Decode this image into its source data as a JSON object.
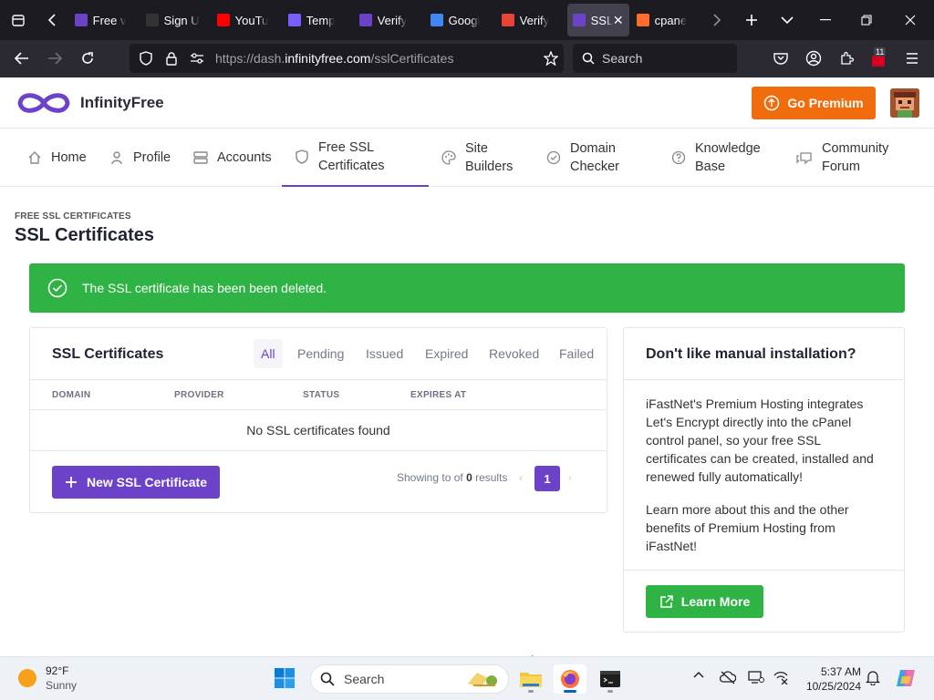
{
  "browser": {
    "tabs": [
      {
        "label": "Free v",
        "favicon_color": "#6b42c8"
      },
      {
        "label": "Sign U",
        "favicon_color": "#333"
      },
      {
        "label": "YouTu",
        "favicon_color": "#ff0000"
      },
      {
        "label": "Temp",
        "favicon_color": "#7b5cff"
      },
      {
        "label": "Verify",
        "favicon_color": "#6b42c8"
      },
      {
        "label": "Googl",
        "favicon_color": "#4285f4"
      },
      {
        "label": "Verify",
        "favicon_color": "#ea4335"
      },
      {
        "label": "SSL",
        "favicon_color": "#6b42c8"
      },
      {
        "label": "cpane",
        "favicon_color": "#ff6c2c"
      }
    ],
    "url_prefix": "https://dash.",
    "url_domain": "infinityfree.com",
    "url_path": "/sslCertificates",
    "search_placeholder": "Search",
    "extension_badge": "11"
  },
  "site": {
    "logo_text": "InfinityFree",
    "premium_button": "Go Premium",
    "nav": [
      {
        "label": "Home",
        "icon": "home-icon"
      },
      {
        "label": "Profile",
        "icon": "user-icon"
      },
      {
        "label": "Accounts",
        "icon": "server-icon"
      },
      {
        "label": "Free SSL Certificates",
        "icon": "shield-icon"
      },
      {
        "label": "Site Builders",
        "icon": "palette-icon"
      },
      {
        "label": "Domain Checker",
        "icon": "check-circle-icon"
      },
      {
        "label": "Knowledge Base",
        "icon": "help-circle-icon"
      },
      {
        "label": "Community Forum",
        "icon": "messages-icon"
      }
    ],
    "nav_active": "Free SSL Certificates"
  },
  "page": {
    "eyebrow": "FREE SSL CERTIFICATES",
    "title": "SSL Certificates",
    "alert": "The SSL certificate has been been deleted."
  },
  "ssl_card": {
    "title": "SSL Certificates",
    "filters": [
      "All",
      "Pending",
      "Issued",
      "Expired",
      "Revoked",
      "Failed"
    ],
    "active_filter": "All",
    "columns": [
      "DOMAIN",
      "PROVIDER",
      "STATUS",
      "EXPIRES AT"
    ],
    "empty_text": "No SSL certificates found",
    "new_button": "New SSL Certificate",
    "showing_prefix": "Showing to of ",
    "showing_count": "0",
    "showing_suffix": " results",
    "pager_prev": "‹",
    "current_page": "1",
    "pager_next": "›"
  },
  "side_card": {
    "title": "Don't like manual installation?",
    "paragraph1": "iFastNet's Premium Hosting integrates Let's Encrypt directly into the cPanel control panel, so your free SSL certificates can be created, installed and renewed fully automatically!",
    "paragraph2": "Learn more about this and the other benefits of Premium Hosting from iFastNet!",
    "button": "Learn More"
  },
  "taskbar": {
    "weather_temp": "92°F",
    "weather_desc": "Sunny",
    "search_placeholder": "Search",
    "time": "5:37 AM",
    "date": "10/25/2024"
  },
  "colors": {
    "brand_purple": "#6b42c8",
    "premium_orange": "#f06c0c",
    "success_green": "#2fb344"
  }
}
